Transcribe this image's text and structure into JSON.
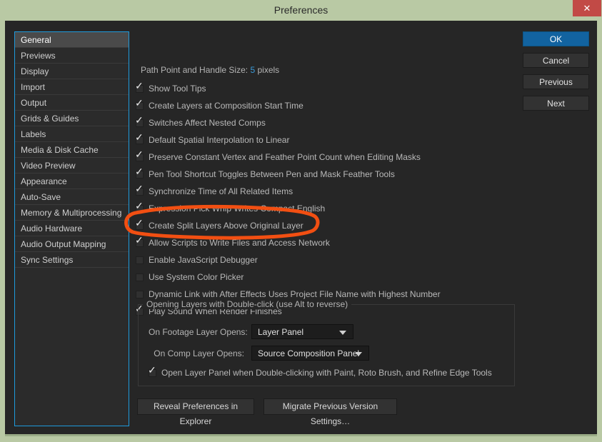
{
  "window": {
    "title": "Preferences",
    "close_label": "✕"
  },
  "sidebar": {
    "items": [
      {
        "label": "General",
        "selected": true
      },
      {
        "label": "Previews",
        "selected": false
      },
      {
        "label": "Display",
        "selected": false
      },
      {
        "label": "Import",
        "selected": false
      },
      {
        "label": "Output",
        "selected": false
      },
      {
        "label": "Grids & Guides",
        "selected": false
      },
      {
        "label": "Labels",
        "selected": false
      },
      {
        "label": "Media & Disk Cache",
        "selected": false
      },
      {
        "label": "Video Preview",
        "selected": false
      },
      {
        "label": "Appearance",
        "selected": false
      },
      {
        "label": "Auto-Save",
        "selected": false
      },
      {
        "label": "Memory & Multiprocessing",
        "selected": false
      },
      {
        "label": "Audio Hardware",
        "selected": false
      },
      {
        "label": "Audio Output Mapping",
        "selected": false
      },
      {
        "label": "Sync Settings",
        "selected": false
      }
    ]
  },
  "main": {
    "path_size": {
      "label": "Path Point and Handle Size:",
      "value": "5",
      "unit": "pixels"
    },
    "checkboxes": [
      {
        "label": "Show Tool Tips",
        "checked": true
      },
      {
        "label": "Create Layers at Composition Start Time",
        "checked": true
      },
      {
        "label": "Switches Affect Nested Comps",
        "checked": true
      },
      {
        "label": "Default Spatial Interpolation to Linear",
        "checked": true
      },
      {
        "label": "Preserve Constant Vertex and Feather Point Count when Editing Masks",
        "checked": true
      },
      {
        "label": "Pen Tool Shortcut Toggles Between Pen and Mask Feather Tools",
        "checked": true
      },
      {
        "label": "Synchronize Time of All Related Items",
        "checked": true
      },
      {
        "label": "Expression Pick Whip Writes Compact English",
        "checked": true
      },
      {
        "label": "Create Split Layers Above Original Layer",
        "checked": true
      },
      {
        "label": "Allow Scripts to Write Files and Access Network",
        "checked": true
      },
      {
        "label": "Enable JavaScript Debugger",
        "checked": false
      },
      {
        "label": "Use System Color Picker",
        "checked": false
      },
      {
        "label": "Dynamic Link with After Effects Uses Project File Name with Highest Number",
        "checked": false
      },
      {
        "label": "Play Sound When Render Finishes",
        "checked": true
      }
    ],
    "group": {
      "legend": "Opening Layers with Double-click (use Alt to reverse)",
      "footage_label": "On Footage Layer Opens:",
      "footage_value": "Layer Panel",
      "comp_label": "On Comp Layer Opens:",
      "comp_value": "Source Composition Panel",
      "checkbox": {
        "label": "Open Layer Panel when Double-clicking with Paint, Roto Brush, and Refine Edge Tools",
        "checked": true
      }
    },
    "buttons": {
      "reveal": "Reveal Preferences in Explorer",
      "migrate": "Migrate Previous Version Settings…"
    }
  },
  "actions": [
    {
      "label": "OK",
      "primary": true
    },
    {
      "label": "Cancel",
      "primary": false
    },
    {
      "label": "Previous",
      "primary": false
    },
    {
      "label": "Next",
      "primary": false
    }
  ],
  "annotation": {
    "color": "#f24f12",
    "target": "Allow Scripts to Write Files and Access Network"
  }
}
